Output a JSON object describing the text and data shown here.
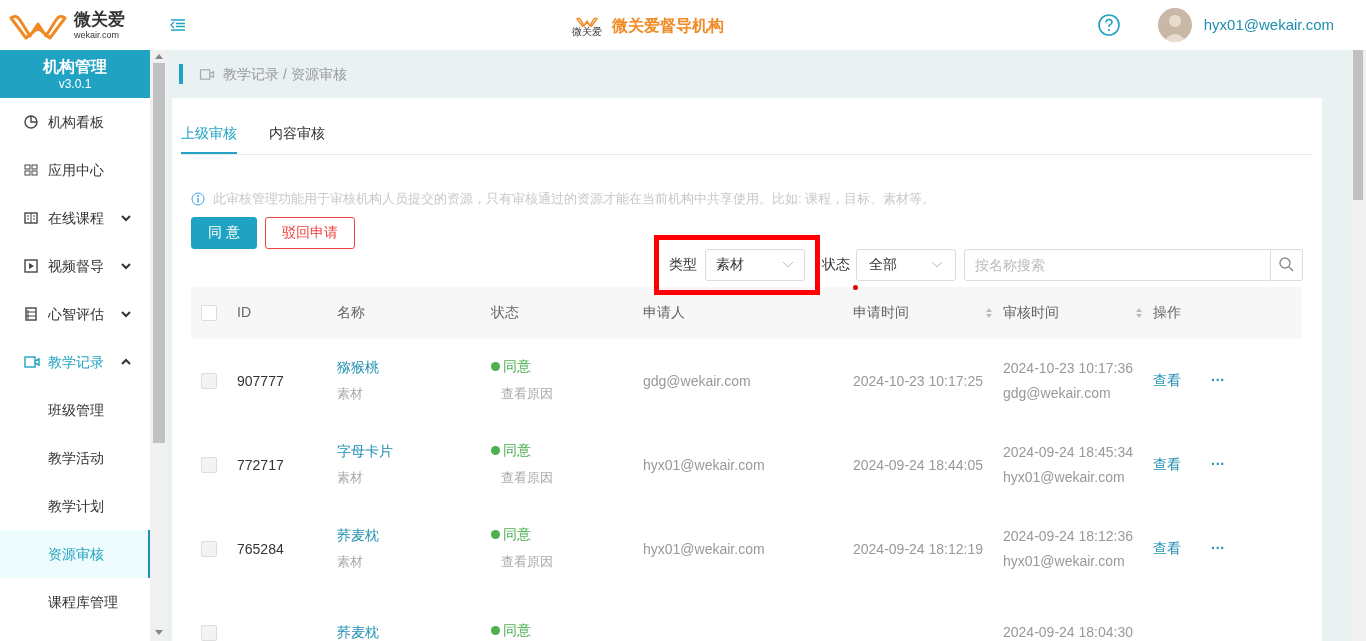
{
  "header": {
    "logo_name": "微关爱",
    "logo_domain": "wekair.com",
    "center_logo_caption": "微关爱",
    "title": "微关爱督导机构",
    "user": "hyx01@wekair.com"
  },
  "sidebar": {
    "title": "机构管理",
    "version": "v3.0.1",
    "items": [
      {
        "label": "机构看板",
        "selected": false
      },
      {
        "label": "应用中心",
        "selected": false
      },
      {
        "label": "在线课程",
        "selected": false,
        "expanded": false
      },
      {
        "label": "视频督导",
        "selected": false,
        "expanded": false
      },
      {
        "label": "心智评估",
        "selected": false,
        "expanded": false
      },
      {
        "label": "教学记录",
        "selected": true,
        "expanded": true,
        "children": [
          {
            "label": "班级管理",
            "selected": false
          },
          {
            "label": "教学活动",
            "selected": false
          },
          {
            "label": "教学计划",
            "selected": false
          },
          {
            "label": "资源审核",
            "selected": true
          },
          {
            "label": "课程库管理",
            "selected": false
          }
        ]
      }
    ]
  },
  "breadcrumb": "教学记录 / 资源审核",
  "tabs": [
    {
      "label": "上级审核",
      "selected": true
    },
    {
      "label": "内容审核",
      "selected": false
    }
  ],
  "notice": "此审核管理功能用于审核机构人员提交的资源，只有审核通过的资源才能在当前机构中共享使用。比如: 课程，目标、素材等。",
  "buttons": [
    {
      "label": "同 意",
      "kind": "primary"
    },
    {
      "label": "驳回申请",
      "kind": "danger"
    }
  ],
  "filters": {
    "type_label": "类型",
    "type_value": "素材",
    "status_label": "状态",
    "status_value": "全部",
    "search_placeholder": "按名称搜索"
  },
  "annotations": [
    {
      "kind": "frame"
    },
    {
      "kind": "dot"
    }
  ],
  "table": {
    "select_all_checked": false,
    "columns": [
      {
        "label": "ID",
        "sortable": false
      },
      {
        "label": "名称",
        "sortable": false
      },
      {
        "label": "状态",
        "sortable": false
      },
      {
        "label": "申请人",
        "sortable": false
      },
      {
        "label": "申请时间",
        "sortable": true
      },
      {
        "label": "审核时间",
        "sortable": true
      },
      {
        "label": "操作",
        "sortable": false
      }
    ],
    "rows": [
      {
        "checked": false,
        "id": "907777",
        "name": "猕猴桃",
        "type": "素材",
        "status": "同意",
        "reason": "查看原因",
        "applicant": "gdg@wekair.com",
        "apply_time": "2024-10-23 10:17:25",
        "review_time": "2024-10-23 10:17:36",
        "reviewer": "gdg@wekair.com",
        "action": "查看",
        "more": "···"
      },
      {
        "checked": false,
        "id": "772717",
        "name": "字母卡片",
        "type": "素材",
        "status": "同意",
        "reason": "查看原因",
        "applicant": "hyx01@wekair.com",
        "apply_time": "2024-09-24 18:44:05",
        "review_time": "2024-09-24 18:45:34",
        "reviewer": "hyx01@wekair.com",
        "action": "查看",
        "more": "···"
      },
      {
        "checked": false,
        "id": "765284",
        "name": "荞麦枕",
        "type": "素材",
        "status": "同意",
        "reason": "查看原因",
        "applicant": "hyx01@wekair.com",
        "apply_time": "2024-09-24 18:12:19",
        "review_time": "2024-09-24 18:12:36",
        "reviewer": "hyx01@wekair.com",
        "action": "查看",
        "more": "···"
      },
      {
        "checked": false,
        "name": "荞麦枕",
        "status": "同意",
        "review_time": "2024-09-24 18:04:30"
      }
    ]
  }
}
